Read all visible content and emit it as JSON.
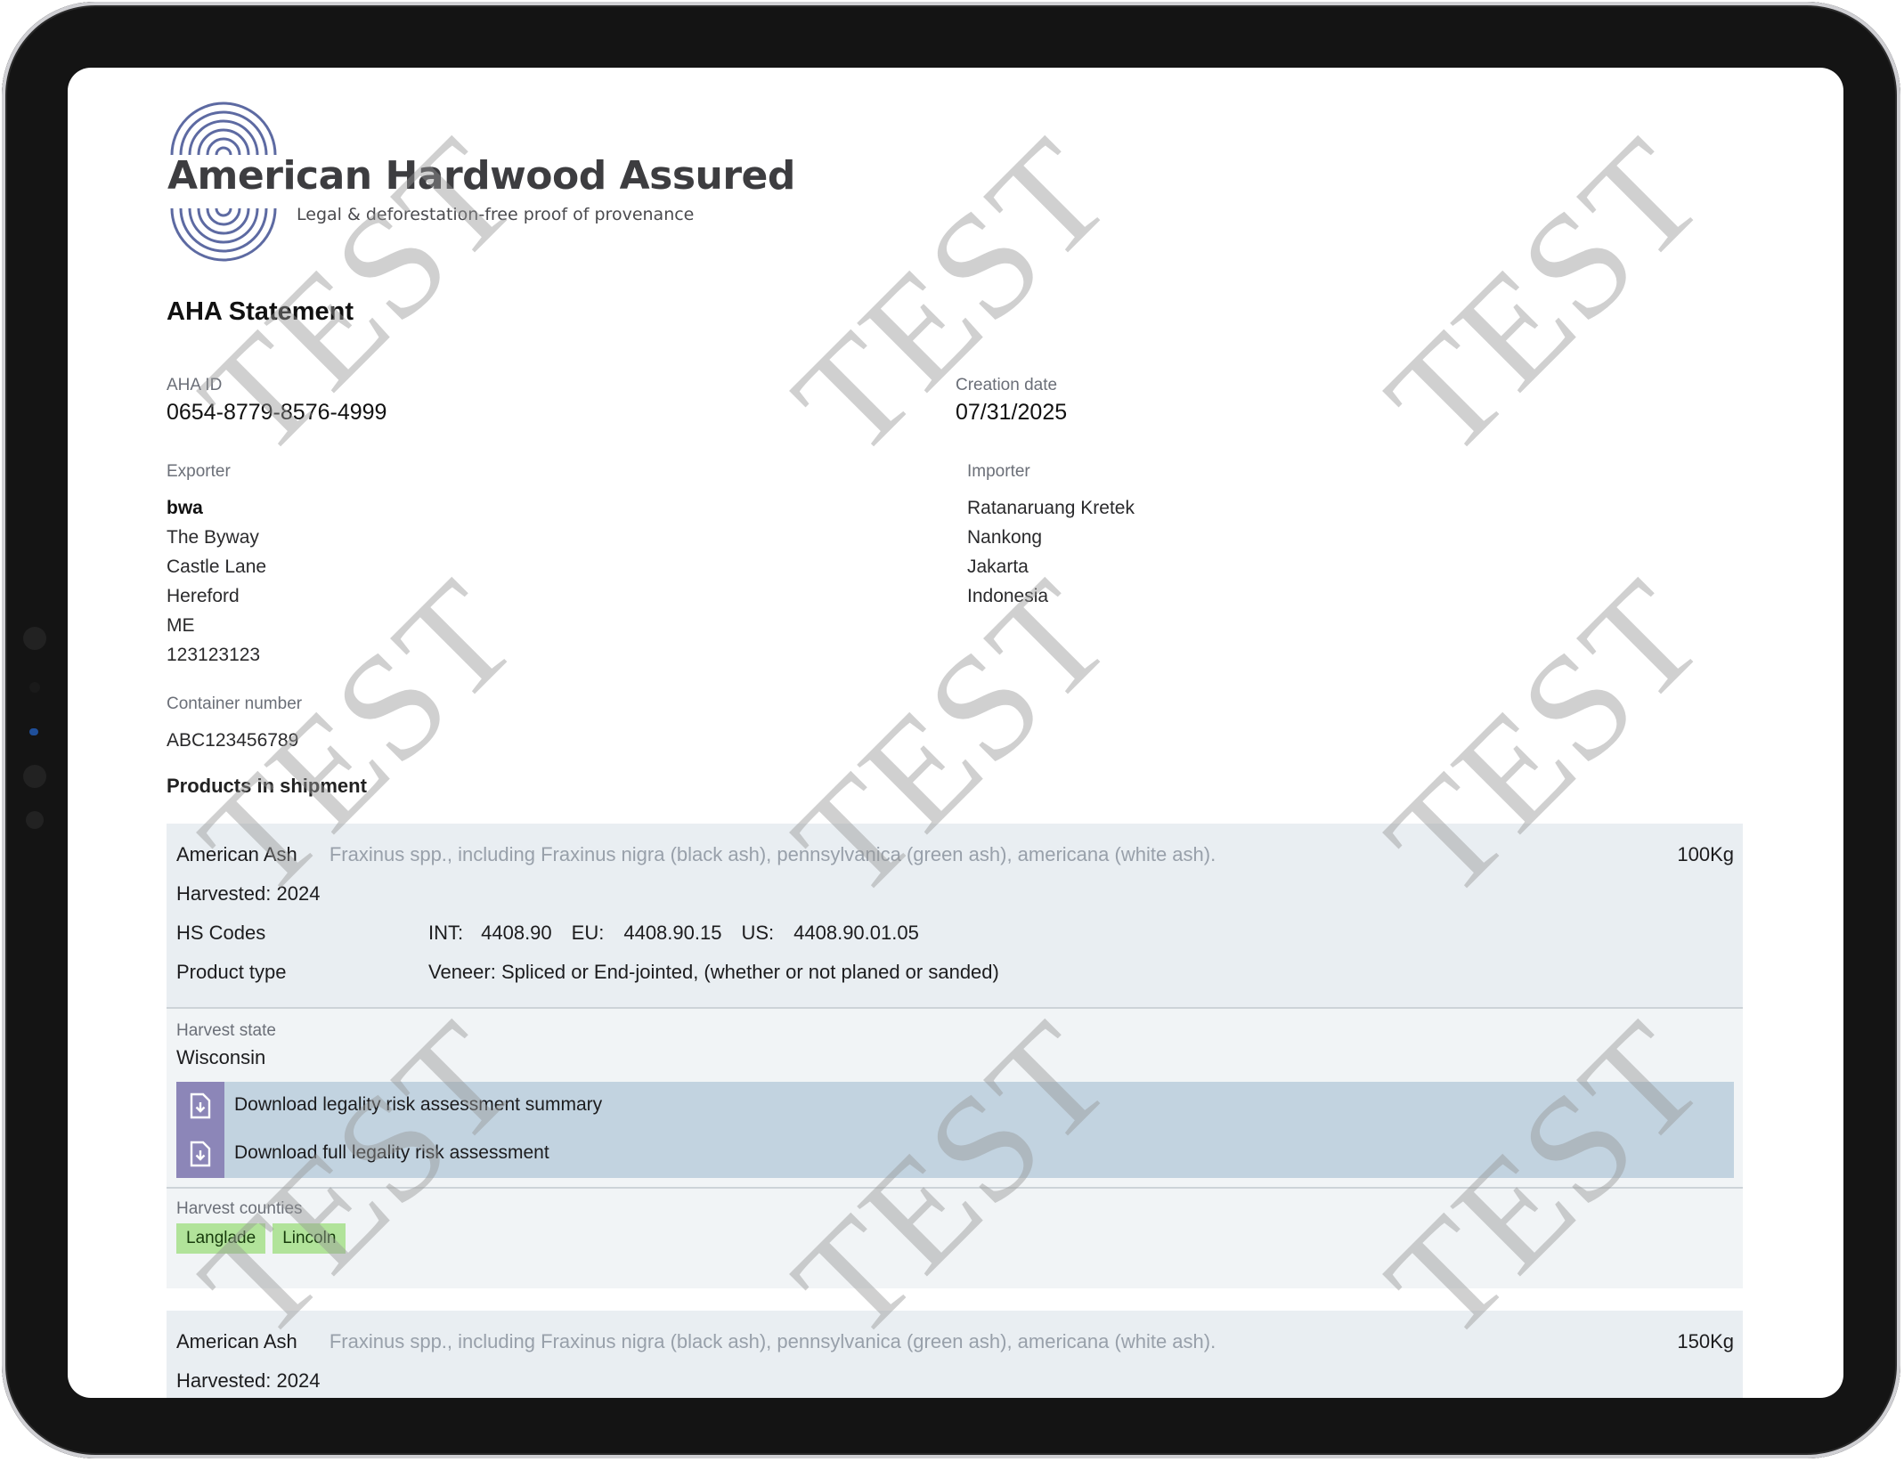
{
  "brand": {
    "name": "American Hardwood Assured",
    "tagline": "Legal & deforestation-free proof of provenance"
  },
  "statement": {
    "title": "AHA Statement",
    "aha_id_label": "AHA ID",
    "aha_id": "0654-8779-8576-4999",
    "creation_date_label": "Creation date",
    "creation_date": "07/31/2025"
  },
  "exporter": {
    "label": "Exporter",
    "lines": [
      "bwa",
      "The Byway",
      "Castle Lane",
      "Hereford",
      "ME",
      "123123123"
    ]
  },
  "importer": {
    "label": "Importer",
    "lines": [
      "Ratanaruang Kretek",
      "Nankong",
      "Jakarta",
      "Indonesia"
    ]
  },
  "container": {
    "label": "Container number",
    "value": "ABC123456789"
  },
  "products_heading": "Products in shipment",
  "products": [
    {
      "name": "American Ash",
      "description": "Fraxinus spp., including Fraxinus nigra (black ash), pennsylvanica (green ash), americana (white ash).",
      "weight": "100Kg",
      "harvested": "Harvested: 2024",
      "hs_label": "HS Codes",
      "hs_int_label": "INT:",
      "hs_int": "4408.90",
      "hs_eu_label": "EU:",
      "hs_eu": "4408.90.15",
      "hs_us_label": "US:",
      "hs_us": "4408.90.01.05",
      "product_type_label": "Product type",
      "product_type": "Veneer: Spliced or End-jointed, (whether or not planed or sanded)",
      "harvest_state_label": "Harvest state",
      "harvest_state": "Wisconsin",
      "download_summary": "Download legality risk assessment summary",
      "download_full": "Download full legality risk assessment",
      "harvest_counties_label": "Harvest counties",
      "counties": [
        "Langlade",
        "Lincoln"
      ]
    },
    {
      "name": "American Ash",
      "description": "Fraxinus spp., including Fraxinus nigra (black ash), pennsylvanica (green ash), americana (white ash).",
      "weight": "150Kg",
      "harvested": "Harvested: 2024"
    }
  ],
  "watermark": "TEST",
  "icons": {
    "download": "download-document-icon",
    "logo": "tree-rings-logo-icon"
  },
  "colors": {
    "card_bg": "#e9eef2",
    "download_bg": "#c2d3e0",
    "download_icon_bg": "#8c86b8",
    "county_tag": "#b1e39a"
  }
}
